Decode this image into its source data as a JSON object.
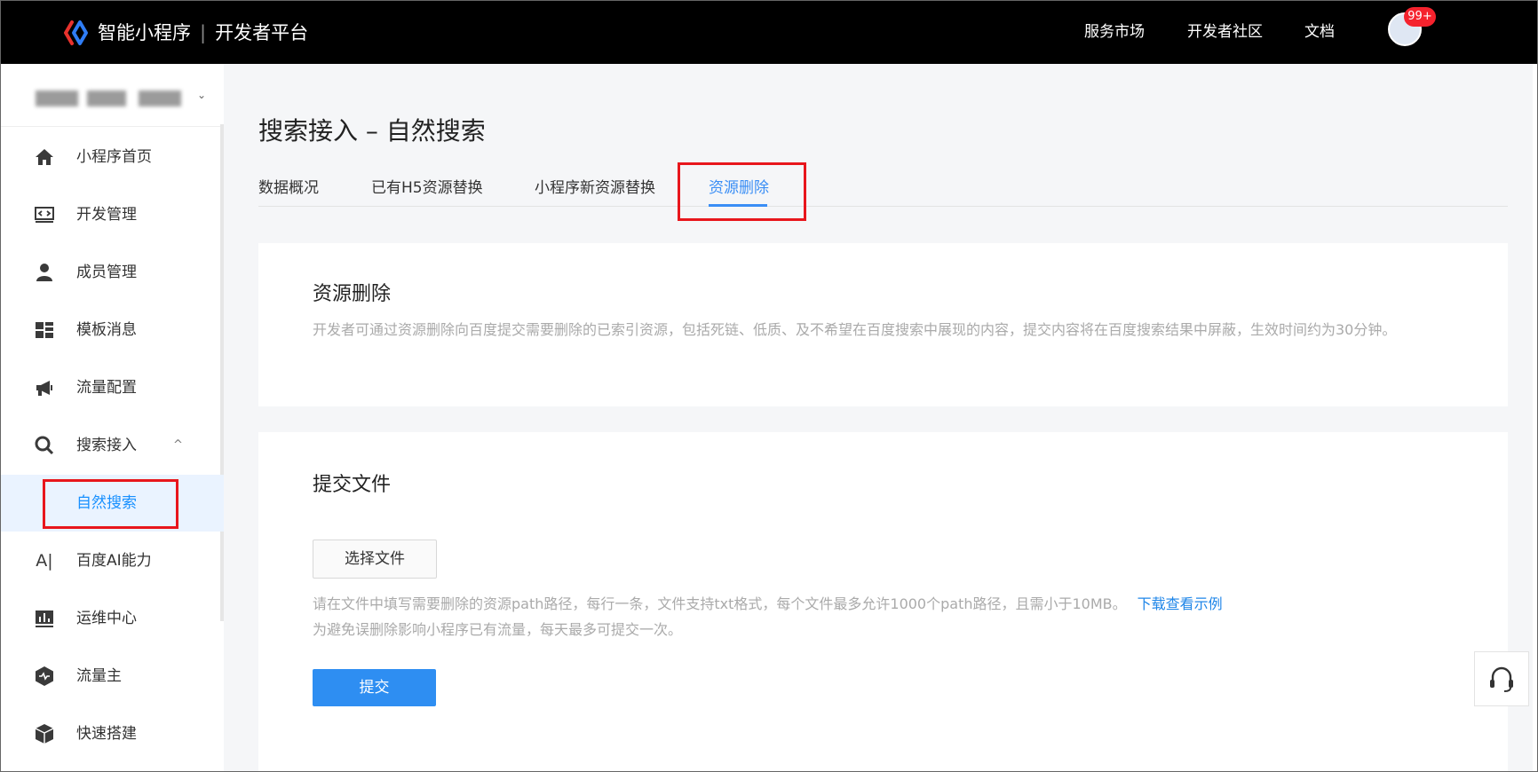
{
  "header": {
    "brand_name": "智能小程序",
    "brand_separator": "|",
    "brand_platform": "开发者平台",
    "nav": [
      "服务市场",
      "开发者社区",
      "文档"
    ],
    "avatar_badge": "99+"
  },
  "sidebar": {
    "account_chevron": "⌄",
    "items": [
      {
        "label": "小程序首页",
        "icon": "home-icon"
      },
      {
        "label": "开发管理",
        "icon": "code-icon"
      },
      {
        "label": "成员管理",
        "icon": "user-icon"
      },
      {
        "label": "模板消息",
        "icon": "template-icon"
      },
      {
        "label": "流量配置",
        "icon": "megaphone-icon"
      },
      {
        "label": "搜索接入",
        "icon": "search-icon",
        "caret": "^"
      },
      {
        "label": "自然搜索",
        "icon": "",
        "active": true
      },
      {
        "label": "百度AI能力",
        "icon": "ai-icon"
      },
      {
        "label": "运维中心",
        "icon": "chart-icon"
      },
      {
        "label": "流量主",
        "icon": "hexagon-icon"
      },
      {
        "label": "快速搭建",
        "icon": "cube-icon"
      }
    ]
  },
  "main": {
    "page_title": "搜索接入 – 自然搜索",
    "tabs": [
      "数据概况",
      "已有H5资源替换",
      "小程序新资源替换",
      "资源删除"
    ],
    "active_tab": "资源删除",
    "intro": {
      "title": "资源删除",
      "description": "开发者可通过资源删除向百度提交需要删除的已索引资源，包括死链、低质、及不希望在百度搜索中展现的内容，提交内容将在百度搜索结果中屏蔽，生效时间约为30分钟。"
    },
    "upload": {
      "title": "提交文件",
      "choose_button": "选择文件",
      "hint_line1": "请在文件中填写需要删除的资源path路径，每行一条，文件支持txt格式，每个文件最多允许1000个path路径，且需小于10MB。",
      "hint_link": "下载查看示例",
      "hint_line2": "为避免误删除影响小程序已有流量，每天最多可提交一次。",
      "submit_button": "提交"
    }
  },
  "colors": {
    "accent": "#2e8ef2",
    "highlight_box": "#e8161c",
    "topbar": "#000000"
  }
}
